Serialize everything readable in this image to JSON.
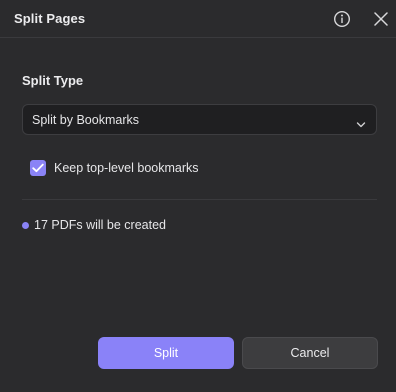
{
  "dialog": {
    "title": "Split Pages",
    "icons": {
      "info": "info-circle-icon",
      "close": "close-icon"
    }
  },
  "split_type": {
    "label": "Split Type",
    "selected": "Split by Bookmarks",
    "dropdown_icon": "chevron-down-icon"
  },
  "option": {
    "label": "Keep top-level bookmarks",
    "checked": true
  },
  "status": {
    "text": "17 PDFs will be created"
  },
  "buttons": {
    "primary": "Split",
    "secondary": "Cancel"
  },
  "colors": {
    "background": "#2b2b2d",
    "accent": "#8a83f6",
    "primary_button": "#8a82f8"
  }
}
